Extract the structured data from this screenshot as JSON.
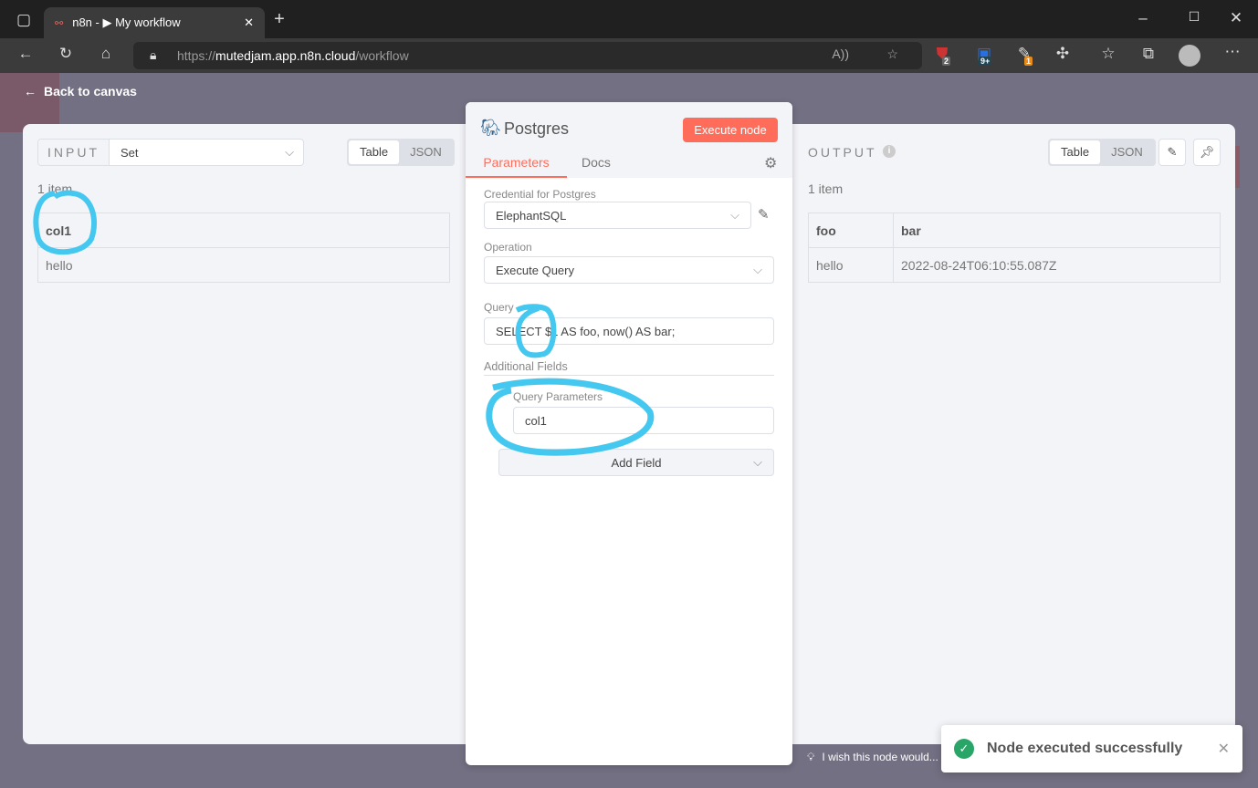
{
  "browser": {
    "tab_title": "n8n - ▶ My workflow",
    "url_scheme": "https://",
    "url_host": "mutedjam.app.n8n.cloud",
    "url_path": "/workflow",
    "ext_badges": [
      "2",
      "9+",
      "1"
    ]
  },
  "app": {
    "back_label": "Back to canvas",
    "feedback": "I wish this node would..."
  },
  "input": {
    "label": "INPUT",
    "source": "Set",
    "view_options": [
      "Table",
      "JSON"
    ],
    "count": "1 item",
    "columns": [
      "col1"
    ],
    "rows": [
      [
        "hello"
      ]
    ]
  },
  "node": {
    "title": "Postgres",
    "execute": "Execute node",
    "tabs": [
      "Parameters",
      "Docs"
    ],
    "credential_label": "Credential for Postgres",
    "credential": "ElephantSQL",
    "operation_label": "Operation",
    "operation": "Execute Query",
    "query_label": "Query",
    "query": "SELECT $1 AS foo, now() AS bar;",
    "additional_label": "Additional Fields",
    "qp_label": "Query Parameters",
    "qp_value": "col1",
    "add_field": "Add Field"
  },
  "output": {
    "label": "OUTPUT",
    "view_options": [
      "Table",
      "JSON"
    ],
    "count": "1 item",
    "columns": [
      "foo",
      "bar"
    ],
    "rows": [
      [
        "hello",
        "2022-08-24T06:10:55.087Z"
      ]
    ]
  },
  "toast": {
    "message": "Node executed successfully"
  },
  "colors": {
    "accent": "#ff6d5a",
    "annotation": "#45c8f0",
    "success": "#29a568"
  }
}
